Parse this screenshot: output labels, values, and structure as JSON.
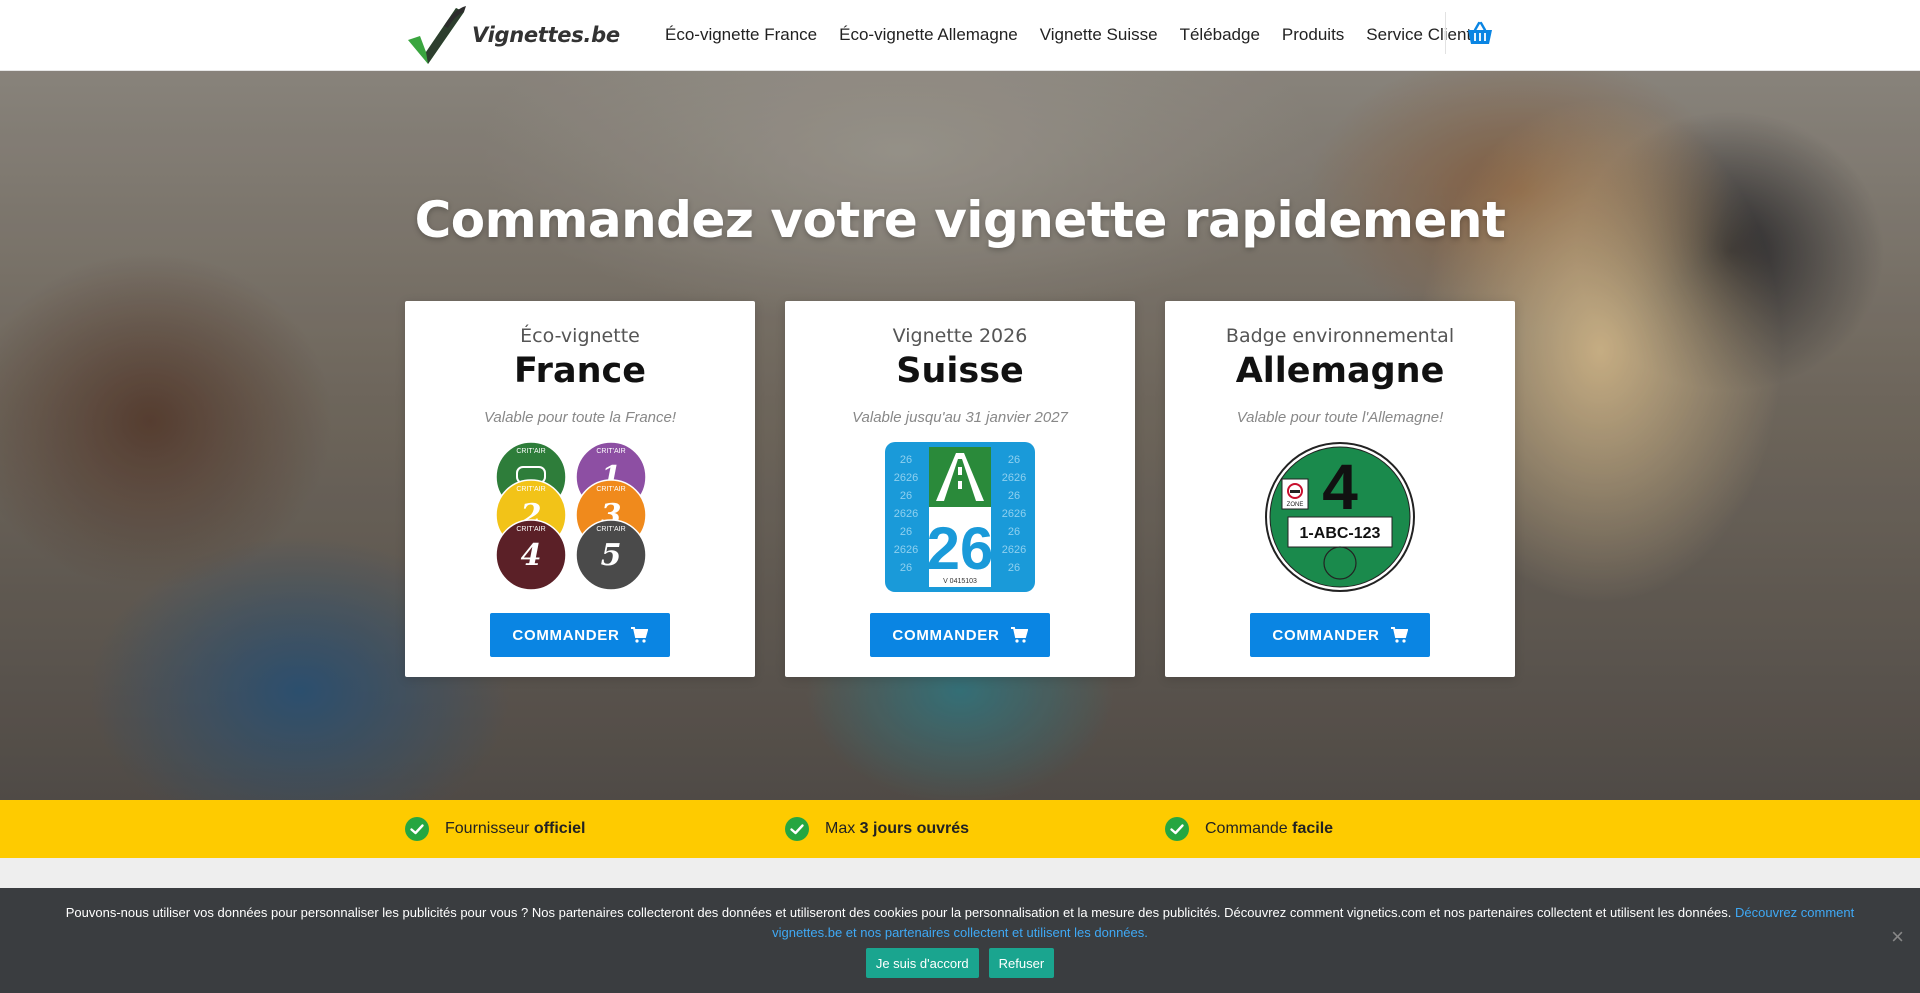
{
  "header": {
    "logo_text": "Vignettes.be",
    "nav": [
      {
        "label": "Éco-vignette France"
      },
      {
        "label": "Éco-vignette Allemagne"
      },
      {
        "label": "Vignette Suisse"
      },
      {
        "label": "Télébadge"
      },
      {
        "label": "Produits"
      },
      {
        "label": "Service Client"
      }
    ],
    "cart_icon": "basket-icon"
  },
  "hero": {
    "title": "Commandez votre vignette rapidement",
    "cards": [
      {
        "subtitle": "Éco-vignette",
        "name": "France",
        "valid": "Valable pour toute la France!",
        "button": "COMMANDER",
        "stickers": [
          {
            "text": "CRIT'AIR",
            "num": "",
            "color": "#2e7d3a"
          },
          {
            "text": "CRIT'AIR",
            "num": "1",
            "color": "#8d4fa3"
          },
          {
            "text": "CRIT'AIR",
            "num": "2",
            "color": "#f2c318"
          },
          {
            "text": "CRIT'AIR",
            "num": "3",
            "color": "#f08a1c"
          },
          {
            "text": "CRIT'AIR",
            "num": "4",
            "color": "#5b2027"
          },
          {
            "text": "CRIT'AIR",
            "num": "5",
            "color": "#4a4a4a"
          }
        ]
      },
      {
        "subtitle": "Vignette 2026",
        "name": "Suisse",
        "valid": "Valable jusqu'au 31 janvier 2027",
        "button": "COMMANDER",
        "sticker": {
          "year": "26",
          "bg_text": "26",
          "serial": "V 0415103",
          "color": "#1a9ad9"
        }
      },
      {
        "subtitle": "Badge environnemental",
        "name": "Allemagne",
        "valid": "Valable pour toute l'Allemagne!",
        "button": "COMMANDER",
        "sticker": {
          "num": "4",
          "plate": "1-ABC-123",
          "zone": "ZONE",
          "color": "#1a8a4c"
        }
      }
    ]
  },
  "features": [
    {
      "text": "Fournisseur ",
      "bold": "officiel"
    },
    {
      "text": "Max ",
      "bold": "3 jours ouvrés"
    },
    {
      "text": "Commande ",
      "bold": "facile"
    }
  ],
  "cookie": {
    "text": "Pouvons-nous utiliser vos données pour personnaliser les publicités pour vous ? Nos partenaires collecteront des données et utiliseront des cookies pour la personnalisation et la mesure des publicités. Découvrez comment vignetics.com et nos partenaires collectent et utilisent les données. ",
    "link": "Découvrez comment vignettes.be et nos partenaires collectent et utilisent les données.",
    "accept": "Je suis d'accord",
    "refuse": "Refuser",
    "close": "×"
  },
  "colors": {
    "accent": "#0a85e3",
    "feature_bar": "#fecb00",
    "check": "#26a641",
    "cookie_bg": "#3a3d40",
    "cookie_btn": "#1aa58f"
  }
}
